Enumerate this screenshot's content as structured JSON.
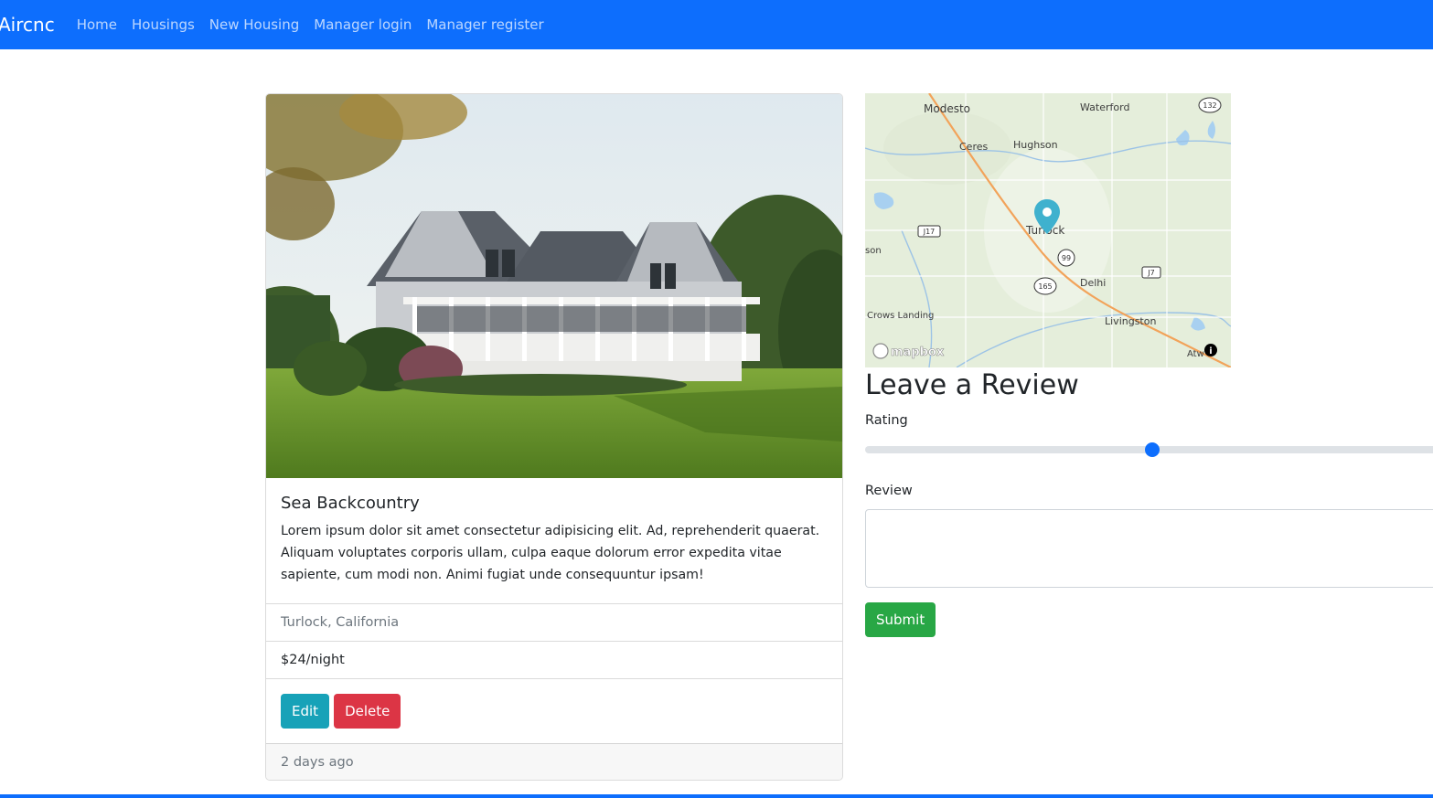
{
  "navbar": {
    "brand": "Aircnc",
    "links": [
      "Home",
      "Housings",
      "New Housing",
      "Manager login",
      "Manager register"
    ]
  },
  "housing": {
    "title": "Sea Backcountry",
    "description": "Lorem ipsum dolor sit amet consectetur adipisicing elit. Ad, reprehenderit quaerat. Aliquam voluptates corporis ullam, culpa eaque dolorum error expedita vitae sapiente, cum modi non. Animi fugiat unde consequuntur ipsam!",
    "location": "Turlock, California",
    "price": "$24/night",
    "edit_label": "Edit",
    "delete_label": "Delete",
    "posted": "2 days ago"
  },
  "map": {
    "places": [
      "Modesto",
      "Waterford",
      "Ceres",
      "Hughson",
      "Turlock",
      "son",
      "Delhi",
      "Crows Landing",
      "Livingston",
      "Atw"
    ],
    "route_shields": [
      "132",
      "J17",
      "99",
      "J7",
      "165"
    ],
    "attribution": "mapbox",
    "marker_place": "Turlock"
  },
  "review": {
    "heading": "Leave a Review",
    "rating_label": "Rating",
    "rating_fraction": 0.49,
    "review_label": "Review",
    "submit_label": "Submit"
  },
  "colors": {
    "primary": "#0d6efd",
    "info": "#17a2b8",
    "danger": "#dc3545",
    "success": "#28a745"
  }
}
